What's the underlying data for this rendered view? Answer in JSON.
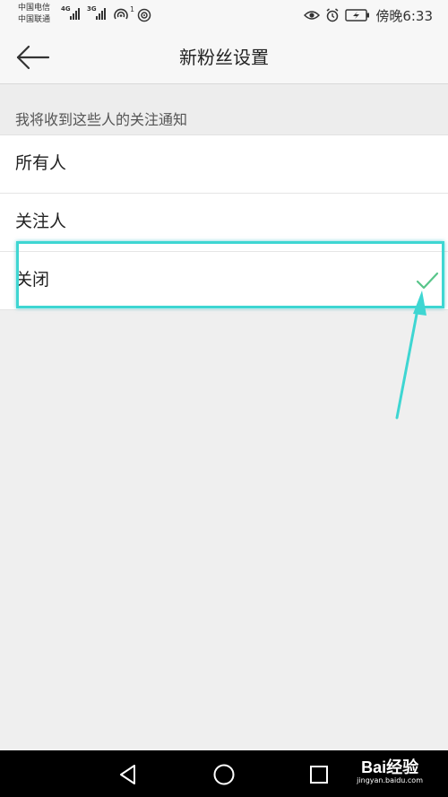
{
  "status_bar": {
    "carrier_1": "中国电信",
    "carrier_2": "中国联通",
    "network_1": "4G",
    "network_2": "3G",
    "hotspot_badge": "1",
    "time": "傍晚6:33",
    "icons": [
      "eye-icon",
      "alarm-icon",
      "battery-charging-icon"
    ]
  },
  "toolbar": {
    "back_icon": "arrow-left-icon",
    "title": "新粉丝设置"
  },
  "section": {
    "header": "我将收到这些人的关注通知"
  },
  "options": [
    {
      "label": "所有人",
      "selected": false
    },
    {
      "label": "关注人",
      "selected": false
    },
    {
      "label": "关闭",
      "selected": true
    }
  ],
  "colors": {
    "check": "#58c58a",
    "highlight": "#3ed6d2"
  },
  "nav_bar": {
    "icons": [
      "back-triangle-icon",
      "home-circle-icon",
      "recents-square-icon"
    ]
  },
  "watermark": {
    "logo": "Bai经验",
    "url": "jingyan.baidu.com"
  }
}
